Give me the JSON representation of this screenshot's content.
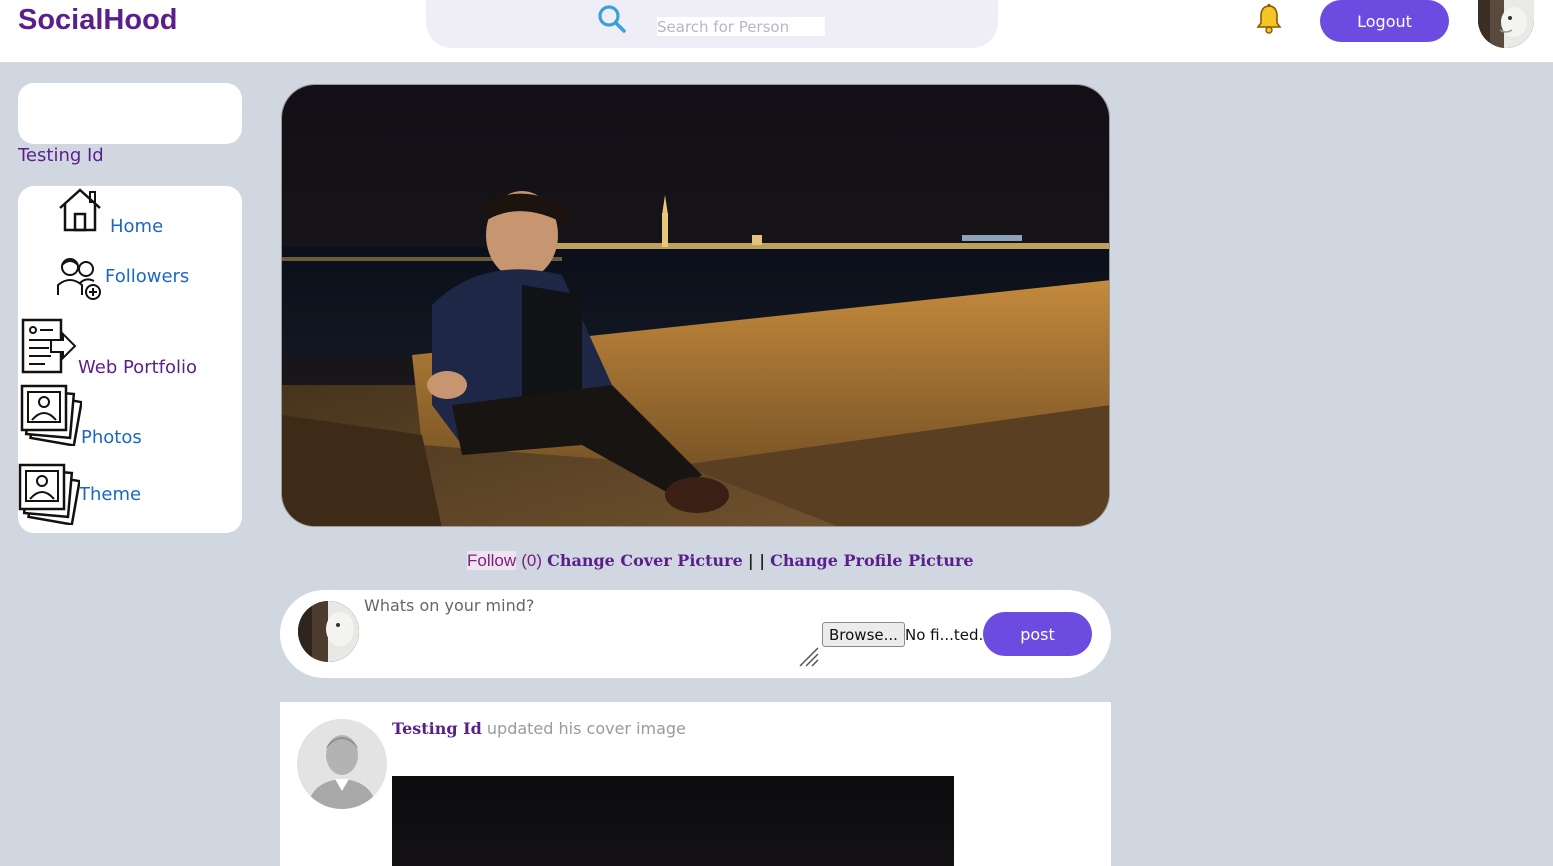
{
  "header": {
    "brand": "SocialHood",
    "search_placeholder": "Search for Person",
    "logout_label": "Logout"
  },
  "sidebar": {
    "username": "Testing Id",
    "items": [
      {
        "label": "Home",
        "icon": "home-icon"
      },
      {
        "label": "Followers",
        "icon": "followers-icon"
      },
      {
        "label": "Web Portfolio",
        "icon": "portfolio-icon"
      },
      {
        "label": "Photos",
        "icon": "photos-icon"
      },
      {
        "label": "Theme",
        "icon": "theme-icon"
      }
    ]
  },
  "profile_actions": {
    "follow_label": "Follow",
    "follow_count": "(0)",
    "change_cover": "Change Cover Picture",
    "separator": "| |",
    "change_profile": "Change Profile Picture"
  },
  "composer": {
    "placeholder": "Whats on your mind?",
    "browse_label": "Browse...",
    "file_status": "No fi...ted.",
    "post_label": "post"
  },
  "feed": [
    {
      "author": "Testing Id",
      "text": "updated his cover image"
    }
  ],
  "colors": {
    "brand": "#5b1f8c",
    "accent": "#6c4ce0",
    "background": "#d0d7e1",
    "link_blue": "#1a67c9"
  }
}
